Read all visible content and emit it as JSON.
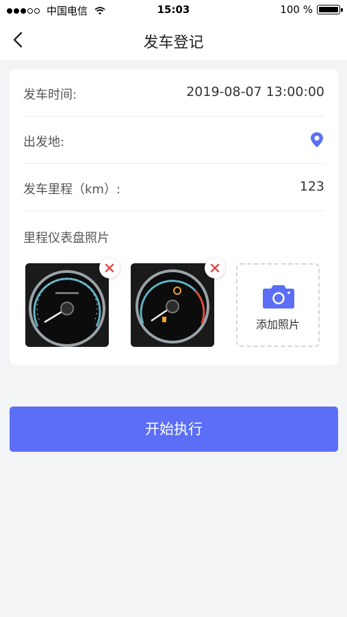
{
  "status_bar": {
    "carrier": "中国电信",
    "time": "15:03",
    "battery": "100 %"
  },
  "header": {
    "title": "发车登记",
    "back_icon": "chevron-left-icon"
  },
  "form": {
    "departure_time": {
      "label": "发车时间:",
      "value": "2019-08-07 13:00:00"
    },
    "origin": {
      "label": "出发地:",
      "icon": "location-pin-icon"
    },
    "mileage": {
      "label": "发车里程（km）:",
      "value": "123"
    },
    "photos": {
      "title": "里程仪表盘照片",
      "count": 2,
      "add_label": "添加照片"
    }
  },
  "actions": {
    "start_label": "开始执行"
  },
  "colors": {
    "accent": "#5b6ef5",
    "delete": "#e2493f",
    "background": "#f3f4f6"
  }
}
